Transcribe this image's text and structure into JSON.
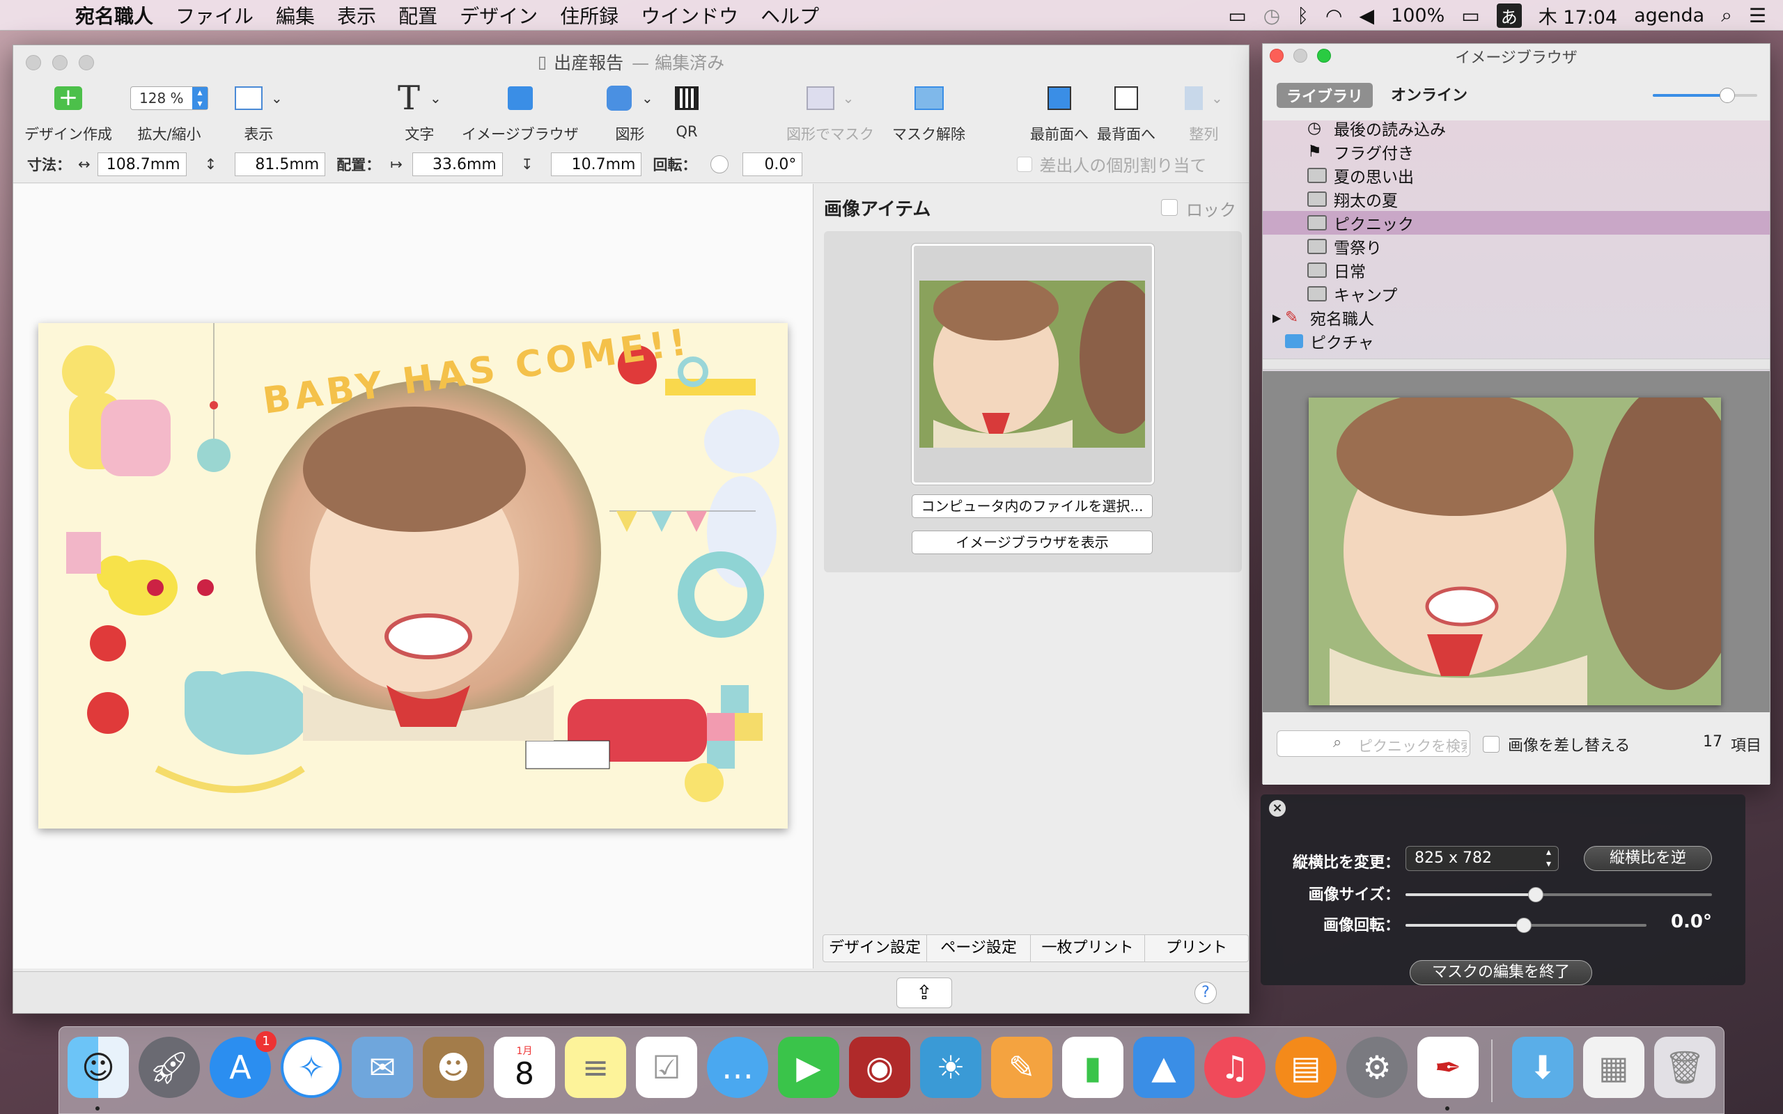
{
  "menubar": {
    "app_name": "宛名職人",
    "items": [
      "ファイル",
      "編集",
      "表示",
      "配置",
      "デザイン",
      "住所録",
      "ウインドウ",
      "ヘルプ"
    ],
    "battery": "100%",
    "input_method": "あ",
    "clock": "木 17:04",
    "user": "agenda"
  },
  "main_window": {
    "title": "出産報告",
    "title_status": "— 編集済み",
    "toolbar": {
      "design_create": "デザイン作成",
      "zoom_label": "拡大/縮小",
      "zoom_value": "128 %",
      "view": "表示",
      "text": "文字",
      "image_browser": "イメージブラウザ",
      "shape": "図形",
      "qr": "QR",
      "mask_by_shape": "図形でマスク",
      "unmask": "マスク解除",
      "bring_front": "最前面へ",
      "send_back": "最背面へ",
      "align": "整列"
    },
    "dimensions": {
      "size_label": "寸法：",
      "width": "108.7mm",
      "height": "81.5mm",
      "position_label": "配置：",
      "x": "33.6mm",
      "y": "10.7mm",
      "rotation_label": "回転：",
      "rotation": "0.0°",
      "sender_assign": "差出人の個別割り当て"
    },
    "card_text": "BABY HAS COME!!",
    "inspector": {
      "title": "画像アイテム",
      "lock": "ロック",
      "choose_file": "コンピュータ内のファイルを選択...",
      "show_browser": "イメージブラウザを表示"
    },
    "bottom_tabs": [
      "デザイン設定",
      "ページ設定",
      "一枚プリント",
      "プリント"
    ],
    "help": "?"
  },
  "image_browser": {
    "title": "イメージブラウザ",
    "tab_library": "ライブラリ",
    "tab_online": "オンライン",
    "slider_value": 0.75,
    "items": [
      "最後の読み込み",
      "フラグ付き",
      "夏の思い出",
      "翔太の夏",
      "ピクニック",
      "雪祭り",
      "日常",
      "キャンプ"
    ],
    "root_app": "宛名職人",
    "root_pictures": "ピクチャ",
    "search_placeholder": "ピクニックを検索",
    "replace_image": "画像を差し替える",
    "count": "17",
    "count_unit": "項目"
  },
  "hud": {
    "aspect_label": "縦横比を変更：",
    "aspect_value": "825 x 782",
    "reverse_aspect": "縦横比を逆",
    "image_size_label": "画像サイズ：",
    "image_size_level": 0.45,
    "rotation_label": "画像回転：",
    "rotation_level": 0.5,
    "rotation_value": "0.0°",
    "end_mask_edit": "マスクの編集を終了"
  },
  "dock": {
    "calendar_month": "1月",
    "calendar_day": "8",
    "appstore_badge": "1"
  },
  "colors": {
    "accent": "#3a8ee6",
    "selection": "#c9a7c7",
    "hud_bg": "#232328"
  }
}
